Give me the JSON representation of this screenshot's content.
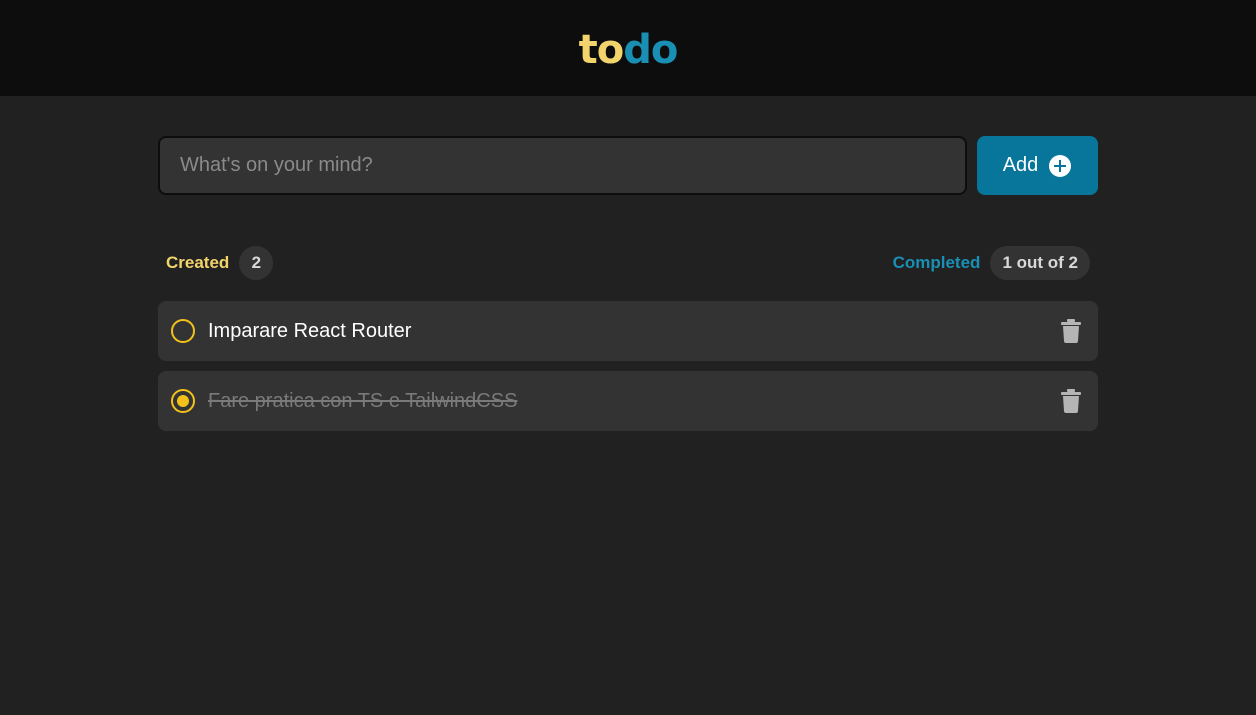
{
  "header": {
    "logo_part1": "to",
    "logo_part2": "do",
    "logo_color1": "#f3d36b",
    "logo_color2": "#1a8fb4"
  },
  "input": {
    "placeholder": "What's on your mind?",
    "value": ""
  },
  "add_button": {
    "label": "Add",
    "icon": "plus-circle-icon"
  },
  "stats": {
    "created_label": "Created",
    "created_count": "2",
    "completed_label": "Completed",
    "completed_count": "1 out of 2"
  },
  "tasks": [
    {
      "text": "Imparare React Router",
      "completed": false,
      "delete_icon": "trash-icon"
    },
    {
      "text": "Fare pratica con TS e TailwindCSS",
      "completed": true,
      "delete_icon": "trash-icon"
    }
  ],
  "colors": {
    "accent_yellow": "#f2c21b",
    "accent_blue": "#08769b",
    "background": "#212121",
    "surface": "#333333",
    "header_bg": "#0d0d0d"
  }
}
